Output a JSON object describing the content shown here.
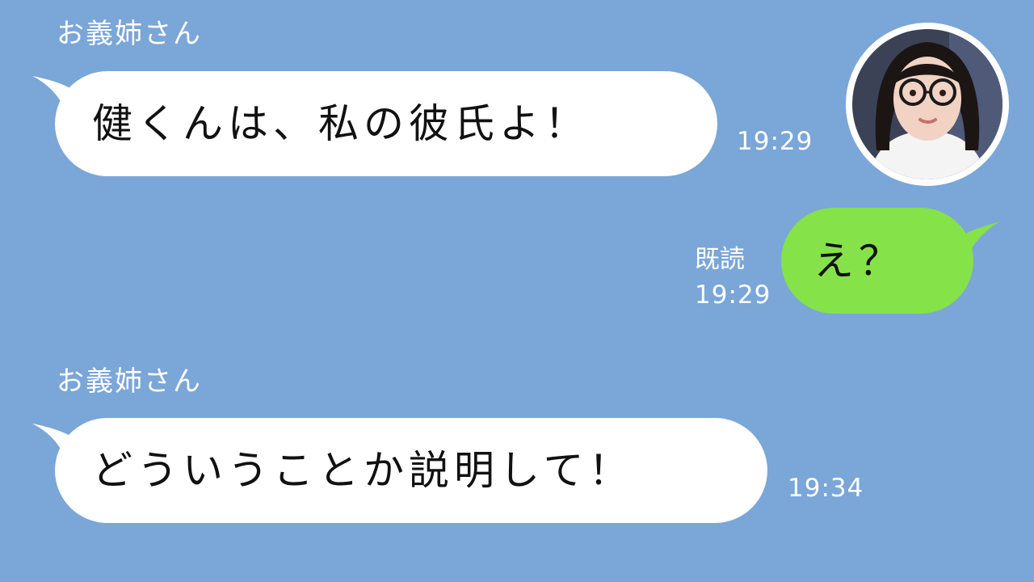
{
  "colors": {
    "background": "#7aa6d8",
    "incoming_bubble": "#ffffff",
    "outgoing_bubble": "#85e249",
    "meta_text": "#ffffff"
  },
  "messages": [
    {
      "direction": "incoming",
      "sender": "お義姉さん",
      "text": "健くんは、私の彼氏よ！",
      "time": "19:29"
    },
    {
      "direction": "outgoing",
      "text": "え？",
      "read_status": "既読",
      "time": "19:29"
    },
    {
      "direction": "incoming",
      "sender": "お義姉さん",
      "text": "どういうことか説明して！",
      "time": "19:34"
    }
  ],
  "avatar": {
    "icon": "contact-avatar-photo"
  }
}
